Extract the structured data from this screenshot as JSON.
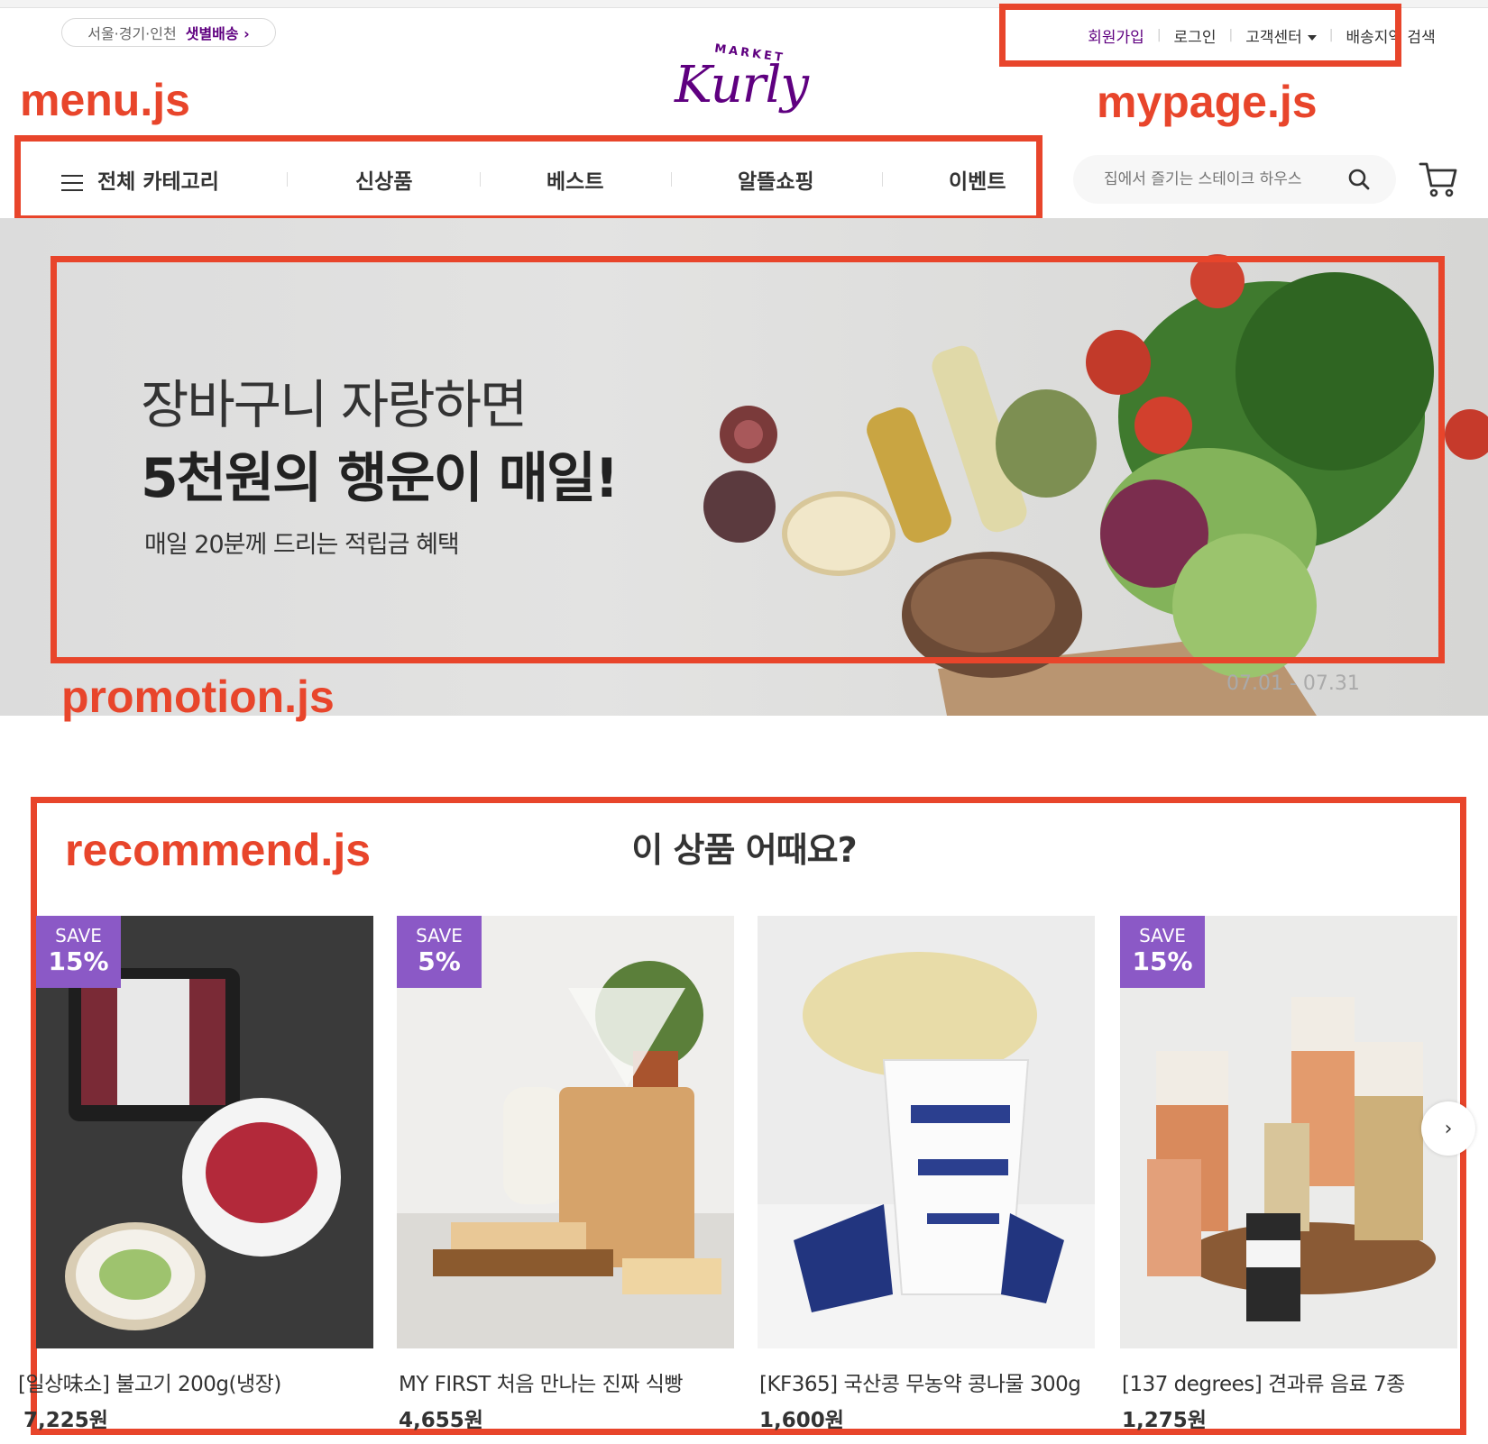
{
  "header": {
    "delivery": {
      "region": "서울·경기·인천",
      "label": "샛별배송"
    },
    "util": {
      "signup": "회원가입",
      "login": "로그인",
      "support": "고객센터",
      "delivery_search": "배송지역 검색"
    },
    "logo": {
      "market": "MARKET",
      "kurly": "Kurly"
    }
  },
  "annotations": {
    "menu": "menu.js",
    "mypage": "mypage.js",
    "promotion": "promotion.js",
    "recommend": "recommend.js"
  },
  "nav": {
    "all_categories": "전체 카테고리",
    "items": [
      "신상품",
      "베스트",
      "알뜰쇼핑",
      "이벤트"
    ]
  },
  "search": {
    "placeholder": "집에서 즐기는 스테이크 하우스"
  },
  "banner": {
    "line1": "장바구니 자랑하면",
    "line2": "5천원의 행운이 매일!",
    "sub": "매일 20분께 드리는 적립금 혜택",
    "period": "07.01 - 07.31"
  },
  "recommend": {
    "title": "이 상품 어때요?",
    "save_label": "SAVE",
    "products": [
      {
        "name": "[일상味소] 불고기 200g(냉장)",
        "price": "7,225원",
        "save": "15%"
      },
      {
        "name": "MY FIRST 처음 만나는 진짜 식빵",
        "price": "4,655원",
        "save": "5%"
      },
      {
        "name": "[KF365] 국산콩 무농약 콩나물 300g",
        "price": "1,600원",
        "save": ""
      },
      {
        "name": "[137 degrees] 견과류 음료 7종",
        "price": "1,275원",
        "save": "15%"
      }
    ]
  },
  "colors": {
    "brand": "#5f0080",
    "annotation": "#e8452b",
    "badge": "#8b59c6"
  }
}
